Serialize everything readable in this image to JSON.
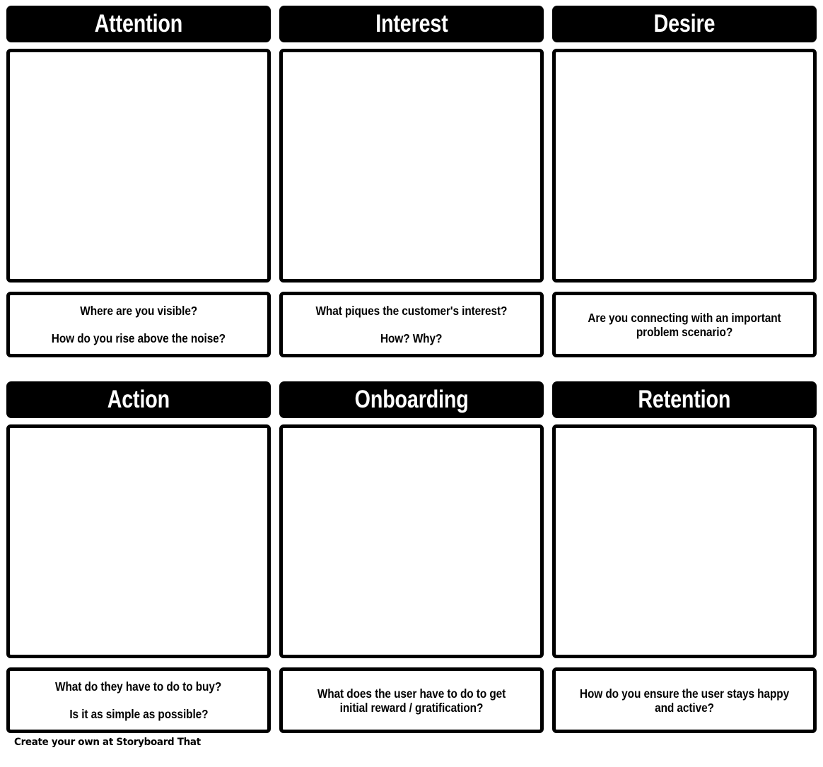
{
  "board": {
    "title": "Create your own at Storyboard That",
    "rows": [
      {
        "cells": [
          {
            "header": "Attention",
            "canvas_empty": true,
            "caption_lines": [
              "Where are you visible?",
              "How do you rise above the noise?"
            ]
          },
          {
            "header": "Interest",
            "canvas_empty": true,
            "caption_lines": [
              "What piques the customer's interest?",
              "How? Why?"
            ]
          },
          {
            "header": "Desire",
            "canvas_empty": true,
            "caption_lines": [
              "Are you connecting with an important problem scenario?"
            ]
          }
        ]
      },
      {
        "cells": [
          {
            "header": "Action",
            "canvas_empty": true,
            "caption_lines": [
              "What do they have to do to buy?",
              "Is it as simple as possible?"
            ]
          },
          {
            "header": "Onboarding",
            "canvas_empty": true,
            "caption_lines": [
              "What does the user have to do to get initial reward / gratification?"
            ]
          },
          {
            "header": "Retention",
            "canvas_empty": true,
            "caption_lines": [
              "How do you ensure the user stays happy and active?"
            ]
          }
        ]
      }
    ]
  },
  "footer": {
    "credit": "Create your own at Storyboard That"
  },
  "colors": {
    "header_background": "#000000",
    "header_text": "#ffffff",
    "border": "#000000",
    "panel_background": "#ffffff",
    "caption_text": "#000000"
  }
}
